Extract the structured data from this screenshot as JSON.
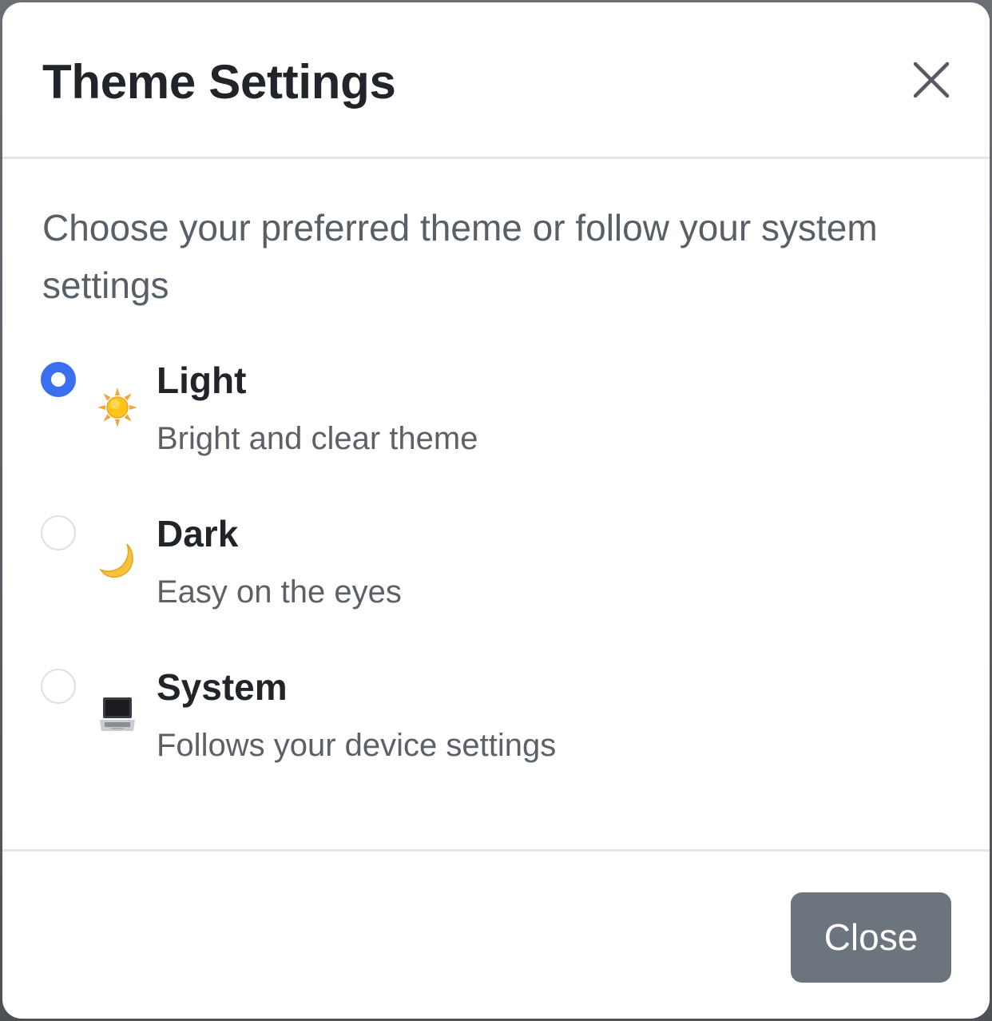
{
  "dialog": {
    "title": "Theme Settings",
    "intro": "Choose your preferred theme or follow your system settings",
    "close_button_label": "Close"
  },
  "theme_options": [
    {
      "label": "Light",
      "description": "Bright and clear theme",
      "icon": "sun-icon",
      "selected": true
    },
    {
      "label": "Dark",
      "description": "Easy on the eyes",
      "icon": "moon-icon",
      "selected": false
    },
    {
      "label": "System",
      "description": "Follows your device settings",
      "icon": "laptop-icon",
      "selected": false
    }
  ],
  "colors": {
    "accent": "#3a6ff0",
    "close_button_bg": "#6c757d",
    "title_text": "#212529",
    "muted_text": "#5b6167"
  }
}
